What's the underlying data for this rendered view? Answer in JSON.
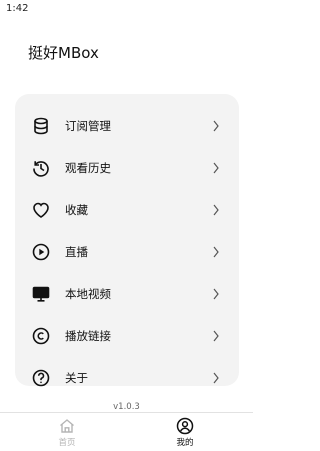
{
  "status_bar": {
    "time": "1:42"
  },
  "app": {
    "title": "挺好MBox"
  },
  "menu": {
    "items": [
      {
        "label": "订阅管理",
        "icon": "database-icon"
      },
      {
        "label": "观看历史",
        "icon": "history-icon"
      },
      {
        "label": "收藏",
        "icon": "heart-icon"
      },
      {
        "label": "直播",
        "icon": "play-circle-icon"
      },
      {
        "label": "本地视频",
        "icon": "monitor-icon"
      },
      {
        "label": "播放链接",
        "icon": "copyright-icon"
      },
      {
        "label": "关于",
        "icon": "help-icon"
      }
    ]
  },
  "version": "v1.0.3",
  "bottom_nav": {
    "tabs": [
      {
        "label": "首页",
        "icon": "home-icon",
        "active": false
      },
      {
        "label": "我的",
        "icon": "user-icon",
        "active": true
      }
    ]
  },
  "colors": {
    "card_bg": "#f3f3f3",
    "active_tab": "#111111",
    "inactive_tab": "#b5b5b5"
  }
}
